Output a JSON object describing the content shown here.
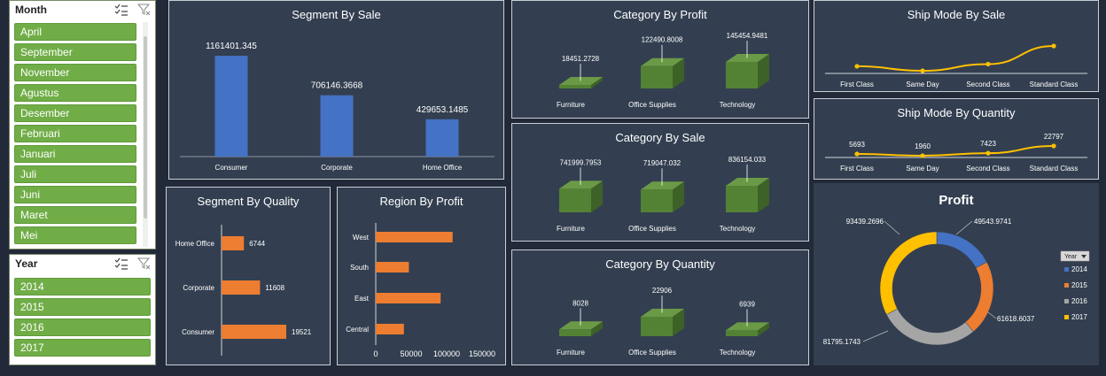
{
  "slicers": {
    "month": {
      "title": "Month",
      "items": [
        "April",
        "September",
        "November",
        "Agustus",
        "Desember",
        "Februari",
        "Januari",
        "Juli",
        "Juni",
        "Maret",
        "Mei"
      ]
    },
    "year": {
      "title": "Year",
      "items": [
        "2014",
        "2015",
        "2016",
        "2017"
      ]
    }
  },
  "colors": {
    "background": "#222938",
    "panel": "#333f50",
    "blue_bar": "#4472c4",
    "orange_bar": "#ed7d31",
    "green_3d": "#548235",
    "gold_line": "#ffc000",
    "slicer_green": "#70ad47"
  },
  "chart_data": [
    {
      "id": "segment_by_sale",
      "type": "bar",
      "title": "Segment By Sale",
      "categories": [
        "Consumer",
        "Corporate",
        "Home Office"
      ],
      "values": [
        1161401.345,
        706146.3668,
        429653.1485
      ],
      "labels": [
        "1161401.345",
        "706146.3668",
        "429653.1485"
      ]
    },
    {
      "id": "category_by_profit",
      "type": "bar",
      "title": "Category By Profit",
      "categories": [
        "Furniture",
        "Office Supplies",
        "Technology"
      ],
      "values": [
        18451.2728,
        122490.8008,
        145454.9481
      ],
      "labels": [
        "18451.2728",
        "122490.8008",
        "145454.9481"
      ]
    },
    {
      "id": "category_by_sale",
      "type": "bar",
      "title": "Category By Sale",
      "categories": [
        "Furniture",
        "Office Supplies",
        "Technology"
      ],
      "values": [
        741999.7953,
        719047.032,
        836154.033
      ],
      "labels": [
        "741999.7953",
        "719047.032",
        "836154.033"
      ]
    },
    {
      "id": "category_by_quantity",
      "type": "bar",
      "title": "Category By Quantity",
      "categories": [
        "Furniture",
        "Office Supplies",
        "Technology"
      ],
      "values": [
        8028,
        22906,
        6939
      ],
      "labels": [
        "8028",
        "22906",
        "6939"
      ]
    },
    {
      "id": "ship_mode_by_sale",
      "type": "line",
      "title": "Ship Mode By Sale",
      "categories": [
        "First Class",
        "Same Day",
        "Second Class",
        "Standard Class"
      ],
      "values": [
        351428,
        128363,
        459194,
        1358216
      ]
    },
    {
      "id": "ship_mode_by_quantity",
      "type": "line",
      "title": "Ship Mode By Quantity",
      "categories": [
        "First Class",
        "Same Day",
        "Second Class",
        "Standard Class"
      ],
      "values": [
        5693,
        1960,
        7423,
        22797
      ],
      "labels": [
        "5693",
        "1960",
        "7423",
        "22797"
      ]
    },
    {
      "id": "segment_by_quality",
      "type": "bar",
      "orientation": "horizontal",
      "title": "Segment By Quality",
      "categories": [
        "Home Office",
        "Corporate",
        "Consumer"
      ],
      "values": [
        6744,
        11608,
        19521
      ],
      "labels": [
        "6744",
        "11608",
        "19521"
      ]
    },
    {
      "id": "region_by_profit",
      "type": "bar",
      "orientation": "horizontal",
      "title": "Region By Profit",
      "categories": [
        "West",
        "South",
        "East",
        "Central"
      ],
      "values": [
        108418,
        46749,
        91523,
        39706
      ],
      "xticks": [
        "0",
        "50000",
        "100000",
        "150000"
      ],
      "xlim": [
        0,
        150000
      ]
    },
    {
      "id": "profit",
      "type": "pie",
      "style": "doughnut",
      "title": "Profit",
      "legend_title": "Year",
      "categories": [
        "2014",
        "2015",
        "2016",
        "2017"
      ],
      "values": [
        49543.9741,
        61618.6037,
        81795.1743,
        93439.2696
      ],
      "labels": [
        "49543.9741",
        "61618.6037",
        "81795.1743",
        "93439.2696"
      ],
      "colors": [
        "#4472c4",
        "#ed7d31",
        "#a5a5a5",
        "#ffc000"
      ],
      "legend_position": "right"
    }
  ]
}
